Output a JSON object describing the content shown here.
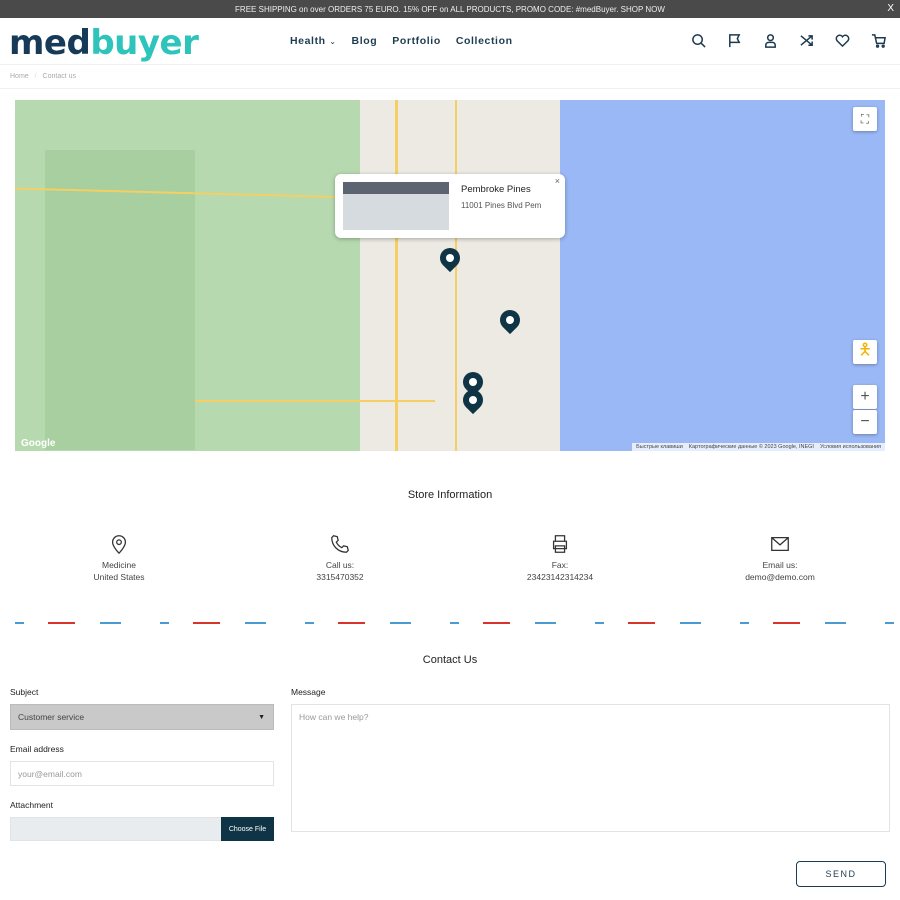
{
  "announcement": {
    "text": "FREE SHIPPING on over ORDERS 75 EURO. 15% OFF on ALL PRODUCTS, PROMO CODE: #medBuyer. SHOP NOW",
    "close": "X"
  },
  "header": {
    "logo_a": "med",
    "logo_b": "buyer",
    "nav": [
      "Health",
      "Blog",
      "Portfolio",
      "Collection"
    ],
    "icons": [
      "search-icon",
      "flag-icon",
      "user-icon",
      "shuffle-icon",
      "heart-icon",
      "cart-icon"
    ]
  },
  "breadcrumb": {
    "home": "Home",
    "sep": "/",
    "current": "Contact us"
  },
  "map": {
    "popup_title": "Pembroke Pines",
    "popup_address": "11001 Pines Blvd Pem",
    "popup_close": "×",
    "zoom_in": "+",
    "zoom_out": "−",
    "google": "Google",
    "attribution": [
      "Быстрые клавиши",
      "Картографические данные © 2023 Google, INEGI",
      "Условия использования"
    ]
  },
  "store": {
    "title": "Store Information",
    "items": [
      {
        "icon": "location-pin-icon",
        "line1": "Medicine",
        "line2": "United States"
      },
      {
        "icon": "phone-icon",
        "line1": "Call us:",
        "line2": "3315470352"
      },
      {
        "icon": "fax-icon",
        "line1": "Fax:",
        "line2": "23423142314234"
      },
      {
        "icon": "mail-icon",
        "line1": "Email us:",
        "line2": "demo@demo.com"
      }
    ]
  },
  "contact": {
    "title": "Contact Us",
    "subject_label": "Subject",
    "subject_value": "Customer service",
    "email_label": "Email address",
    "email_placeholder": "your@email.com",
    "attachment_label": "Attachment",
    "choose_file": "Choose File",
    "message_label": "Message",
    "message_placeholder": "How can we help?",
    "send": "SEND"
  },
  "colors": {
    "brand_dark": "#163a57",
    "brand_teal": "#2ec4bc",
    "button": "#0f3446"
  }
}
